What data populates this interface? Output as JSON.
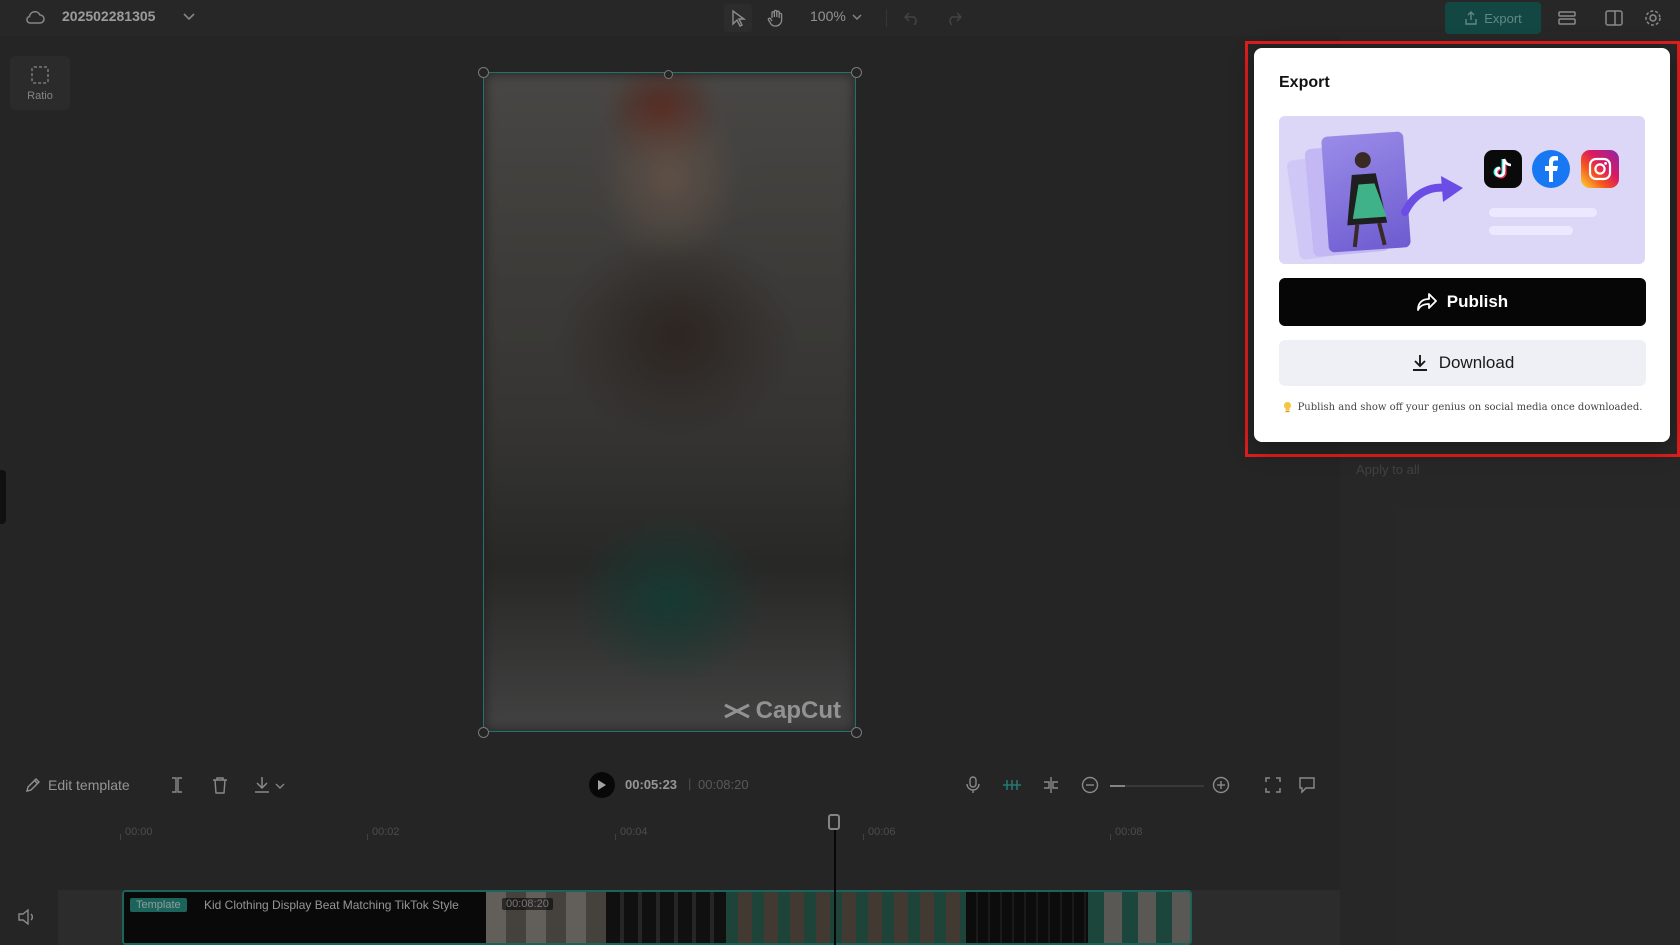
{
  "topbar": {
    "project_name": "202502281305",
    "zoom_level": "100%",
    "export_label": "Export"
  },
  "canvas": {
    "ratio_label": "Ratio",
    "watermark": "CapCut"
  },
  "right_panel": {
    "apply_to_all": "Apply to all"
  },
  "controls": {
    "edit_template_label": "Edit template",
    "current_time": "00:05:23",
    "separator": "|",
    "total_time": "00:08:20",
    "timeline_zoom": 0.16
  },
  "timeline": {
    "ruler_ticks": [
      "00:00",
      "00:02",
      "00:04",
      "00:06",
      "00:08"
    ],
    "clip": {
      "tag": "Template",
      "title": "Kid Clothing Display Beat Matching TikTok Style",
      "duration": "00:08:20"
    }
  },
  "export_popup": {
    "title": "Export",
    "publish_label": "Publish",
    "download_label": "Download",
    "tip": "Publish and show off your genius on social media once downloaded.",
    "social_icons": [
      "tiktok-icon",
      "facebook-icon",
      "instagram-icon"
    ]
  },
  "colors": {
    "accent_teal": "#2a9d8f",
    "highlight_red": "#e11d1d",
    "publish_bg": "#060606",
    "download_bg": "#eef0f5"
  }
}
